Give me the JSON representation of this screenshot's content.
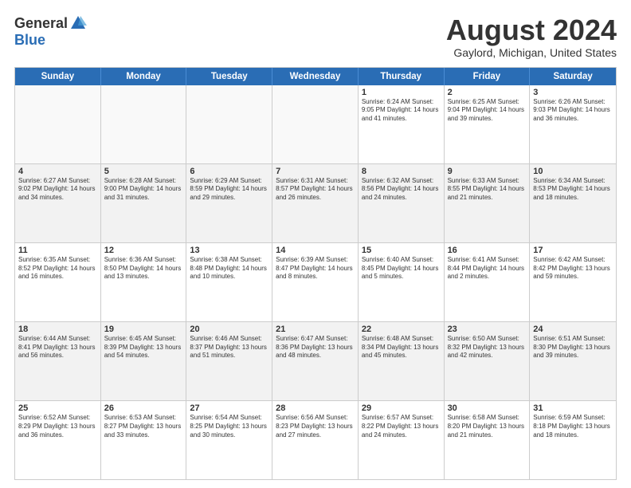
{
  "logo": {
    "general": "General",
    "blue": "Blue"
  },
  "header": {
    "month_year": "August 2024",
    "location": "Gaylord, Michigan, United States"
  },
  "days_of_week": [
    "Sunday",
    "Monday",
    "Tuesday",
    "Wednesday",
    "Thursday",
    "Friday",
    "Saturday"
  ],
  "rows": [
    [
      {
        "day": "",
        "info": "",
        "empty": true
      },
      {
        "day": "",
        "info": "",
        "empty": true
      },
      {
        "day": "",
        "info": "",
        "empty": true
      },
      {
        "day": "",
        "info": "",
        "empty": true
      },
      {
        "day": "1",
        "info": "Sunrise: 6:24 AM\nSunset: 9:05 PM\nDaylight: 14 hours\nand 41 minutes.",
        "empty": false
      },
      {
        "day": "2",
        "info": "Sunrise: 6:25 AM\nSunset: 9:04 PM\nDaylight: 14 hours\nand 39 minutes.",
        "empty": false
      },
      {
        "day": "3",
        "info": "Sunrise: 6:26 AM\nSunset: 9:03 PM\nDaylight: 14 hours\nand 36 minutes.",
        "empty": false
      }
    ],
    [
      {
        "day": "4",
        "info": "Sunrise: 6:27 AM\nSunset: 9:02 PM\nDaylight: 14 hours\nand 34 minutes.",
        "empty": false
      },
      {
        "day": "5",
        "info": "Sunrise: 6:28 AM\nSunset: 9:00 PM\nDaylight: 14 hours\nand 31 minutes.",
        "empty": false
      },
      {
        "day": "6",
        "info": "Sunrise: 6:29 AM\nSunset: 8:59 PM\nDaylight: 14 hours\nand 29 minutes.",
        "empty": false
      },
      {
        "day": "7",
        "info": "Sunrise: 6:31 AM\nSunset: 8:57 PM\nDaylight: 14 hours\nand 26 minutes.",
        "empty": false
      },
      {
        "day": "8",
        "info": "Sunrise: 6:32 AM\nSunset: 8:56 PM\nDaylight: 14 hours\nand 24 minutes.",
        "empty": false
      },
      {
        "day": "9",
        "info": "Sunrise: 6:33 AM\nSunset: 8:55 PM\nDaylight: 14 hours\nand 21 minutes.",
        "empty": false
      },
      {
        "day": "10",
        "info": "Sunrise: 6:34 AM\nSunset: 8:53 PM\nDaylight: 14 hours\nand 18 minutes.",
        "empty": false
      }
    ],
    [
      {
        "day": "11",
        "info": "Sunrise: 6:35 AM\nSunset: 8:52 PM\nDaylight: 14 hours\nand 16 minutes.",
        "empty": false
      },
      {
        "day": "12",
        "info": "Sunrise: 6:36 AM\nSunset: 8:50 PM\nDaylight: 14 hours\nand 13 minutes.",
        "empty": false
      },
      {
        "day": "13",
        "info": "Sunrise: 6:38 AM\nSunset: 8:48 PM\nDaylight: 14 hours\nand 10 minutes.",
        "empty": false
      },
      {
        "day": "14",
        "info": "Sunrise: 6:39 AM\nSunset: 8:47 PM\nDaylight: 14 hours\nand 8 minutes.",
        "empty": false
      },
      {
        "day": "15",
        "info": "Sunrise: 6:40 AM\nSunset: 8:45 PM\nDaylight: 14 hours\nand 5 minutes.",
        "empty": false
      },
      {
        "day": "16",
        "info": "Sunrise: 6:41 AM\nSunset: 8:44 PM\nDaylight: 14 hours\nand 2 minutes.",
        "empty": false
      },
      {
        "day": "17",
        "info": "Sunrise: 6:42 AM\nSunset: 8:42 PM\nDaylight: 13 hours\nand 59 minutes.",
        "empty": false
      }
    ],
    [
      {
        "day": "18",
        "info": "Sunrise: 6:44 AM\nSunset: 8:41 PM\nDaylight: 13 hours\nand 56 minutes.",
        "empty": false
      },
      {
        "day": "19",
        "info": "Sunrise: 6:45 AM\nSunset: 8:39 PM\nDaylight: 13 hours\nand 54 minutes.",
        "empty": false
      },
      {
        "day": "20",
        "info": "Sunrise: 6:46 AM\nSunset: 8:37 PM\nDaylight: 13 hours\nand 51 minutes.",
        "empty": false
      },
      {
        "day": "21",
        "info": "Sunrise: 6:47 AM\nSunset: 8:36 PM\nDaylight: 13 hours\nand 48 minutes.",
        "empty": false
      },
      {
        "day": "22",
        "info": "Sunrise: 6:48 AM\nSunset: 8:34 PM\nDaylight: 13 hours\nand 45 minutes.",
        "empty": false
      },
      {
        "day": "23",
        "info": "Sunrise: 6:50 AM\nSunset: 8:32 PM\nDaylight: 13 hours\nand 42 minutes.",
        "empty": false
      },
      {
        "day": "24",
        "info": "Sunrise: 6:51 AM\nSunset: 8:30 PM\nDaylight: 13 hours\nand 39 minutes.",
        "empty": false
      }
    ],
    [
      {
        "day": "25",
        "info": "Sunrise: 6:52 AM\nSunset: 8:29 PM\nDaylight: 13 hours\nand 36 minutes.",
        "empty": false
      },
      {
        "day": "26",
        "info": "Sunrise: 6:53 AM\nSunset: 8:27 PM\nDaylight: 13 hours\nand 33 minutes.",
        "empty": false
      },
      {
        "day": "27",
        "info": "Sunrise: 6:54 AM\nSunset: 8:25 PM\nDaylight: 13 hours\nand 30 minutes.",
        "empty": false
      },
      {
        "day": "28",
        "info": "Sunrise: 6:56 AM\nSunset: 8:23 PM\nDaylight: 13 hours\nand 27 minutes.",
        "empty": false
      },
      {
        "day": "29",
        "info": "Sunrise: 6:57 AM\nSunset: 8:22 PM\nDaylight: 13 hours\nand 24 minutes.",
        "empty": false
      },
      {
        "day": "30",
        "info": "Sunrise: 6:58 AM\nSunset: 8:20 PM\nDaylight: 13 hours\nand 21 minutes.",
        "empty": false
      },
      {
        "day": "31",
        "info": "Sunrise: 6:59 AM\nSunset: 8:18 PM\nDaylight: 13 hours\nand 18 minutes.",
        "empty": false
      }
    ]
  ]
}
